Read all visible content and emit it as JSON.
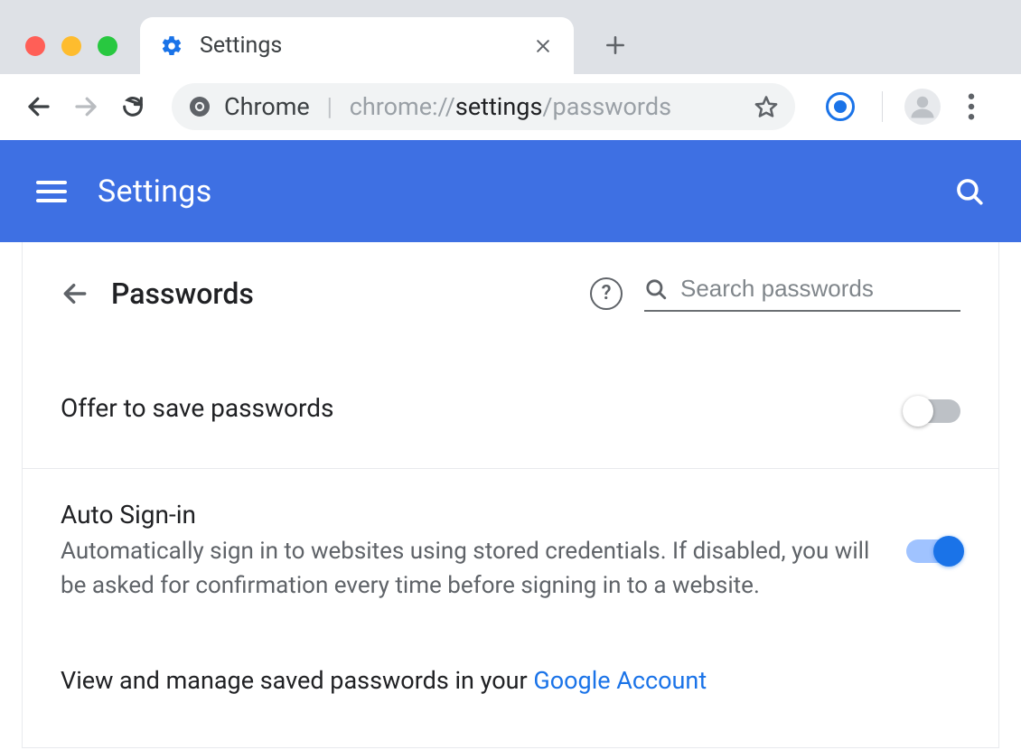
{
  "window": {
    "tab_title": "Settings"
  },
  "toolbar": {
    "chrome_label": "Chrome",
    "url_prefix": "chrome://",
    "url_bold": "settings",
    "url_suffix": "/passwords"
  },
  "header": {
    "title": "Settings"
  },
  "page": {
    "title": "Passwords",
    "search_placeholder": "Search passwords",
    "settings": {
      "offer_save": {
        "title": "Offer to save passwords",
        "enabled": false
      },
      "auto_signin": {
        "title": "Auto Sign-in",
        "description": "Automatically sign in to websites using stored credentials. If disabled, you will be asked for confirmation every time before signing in to a website.",
        "enabled": true
      }
    },
    "footer": {
      "text": "View and manage saved passwords in your ",
      "link": "Google Account"
    }
  }
}
